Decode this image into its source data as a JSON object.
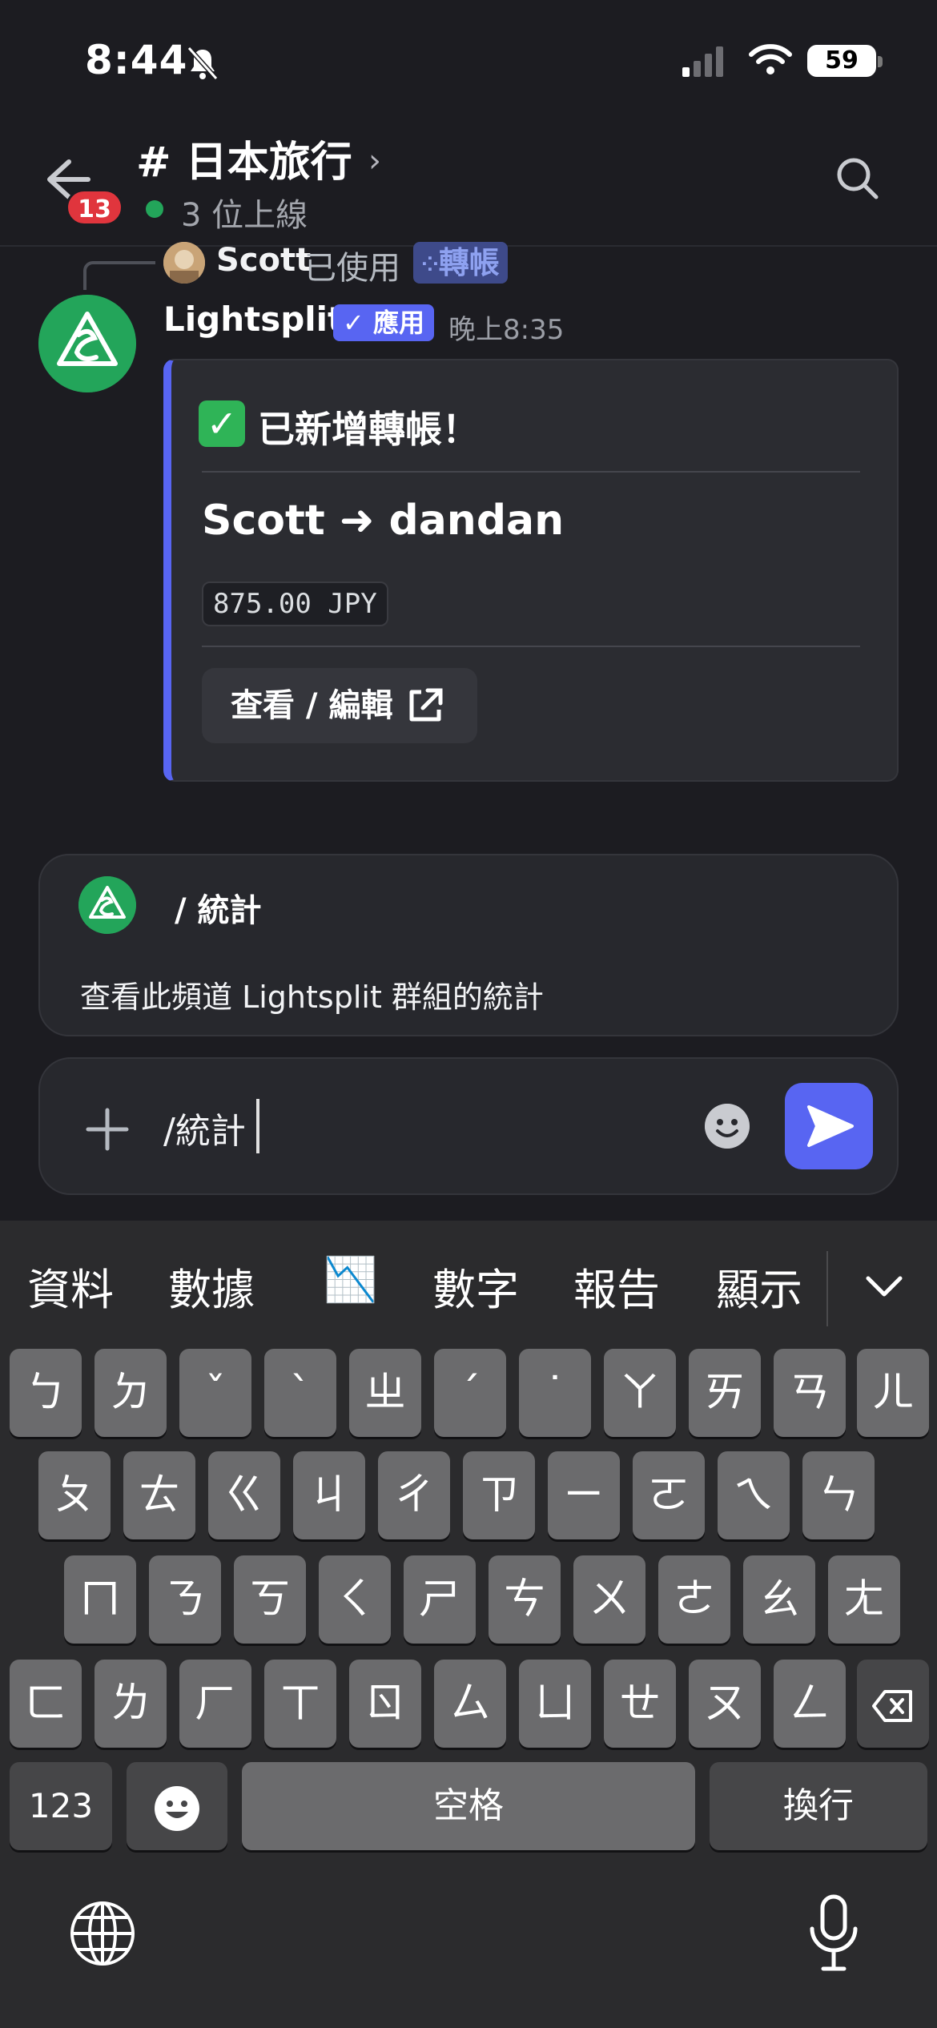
{
  "status_bar": {
    "time": "8:44",
    "battery": "59"
  },
  "header": {
    "unread_count": "13",
    "channel": "# 日本旅行",
    "online": "3 位上線"
  },
  "reply": {
    "user": "Scott",
    "used_text": "已使用",
    "command": "轉帳"
  },
  "message": {
    "bot_name": "Lightsplit",
    "app_badge": "✓ 應用",
    "time": "晚上8:35",
    "embed": {
      "check": "✓",
      "title": "已新增轉帳！",
      "transfer": "Scott ➜ dandan",
      "amount": "875.00 JPY",
      "button": "查看 / 編輯"
    }
  },
  "suggestion": {
    "command": "/ 統計",
    "description": "查看此頻道 Lightsplit 群組的統計"
  },
  "composer": {
    "input_value": "/統計"
  },
  "keyboard": {
    "candidates": [
      "資料",
      "數據",
      "📉",
      "數字",
      "報告",
      "顯示"
    ],
    "row1": [
      "ㄅ",
      "ㄉ",
      "ˇ",
      "ˋ",
      "ㄓ",
      "ˊ",
      "˙",
      "ㄚ",
      "ㄞ",
      "ㄢ",
      "ㄦ"
    ],
    "row2": [
      "ㄆ",
      "ㄊ",
      "ㄍ",
      "ㄐ",
      "ㄔ",
      "ㄗ",
      "ㄧ",
      "ㄛ",
      "ㄟ",
      "ㄣ"
    ],
    "row3": [
      "ㄇ",
      "ㄋ",
      "ㄎ",
      "ㄑ",
      "ㄕ",
      "ㄘ",
      "ㄨ",
      "ㄜ",
      "ㄠ",
      "ㄤ"
    ],
    "row4": [
      "ㄈ",
      "ㄌ",
      "ㄏ",
      "ㄒ",
      "ㄖ",
      "ㄙ",
      "ㄩ",
      "ㄝ",
      "ㄡ",
      "ㄥ"
    ],
    "key_123": "123",
    "space": "空格",
    "return": "換行"
  }
}
